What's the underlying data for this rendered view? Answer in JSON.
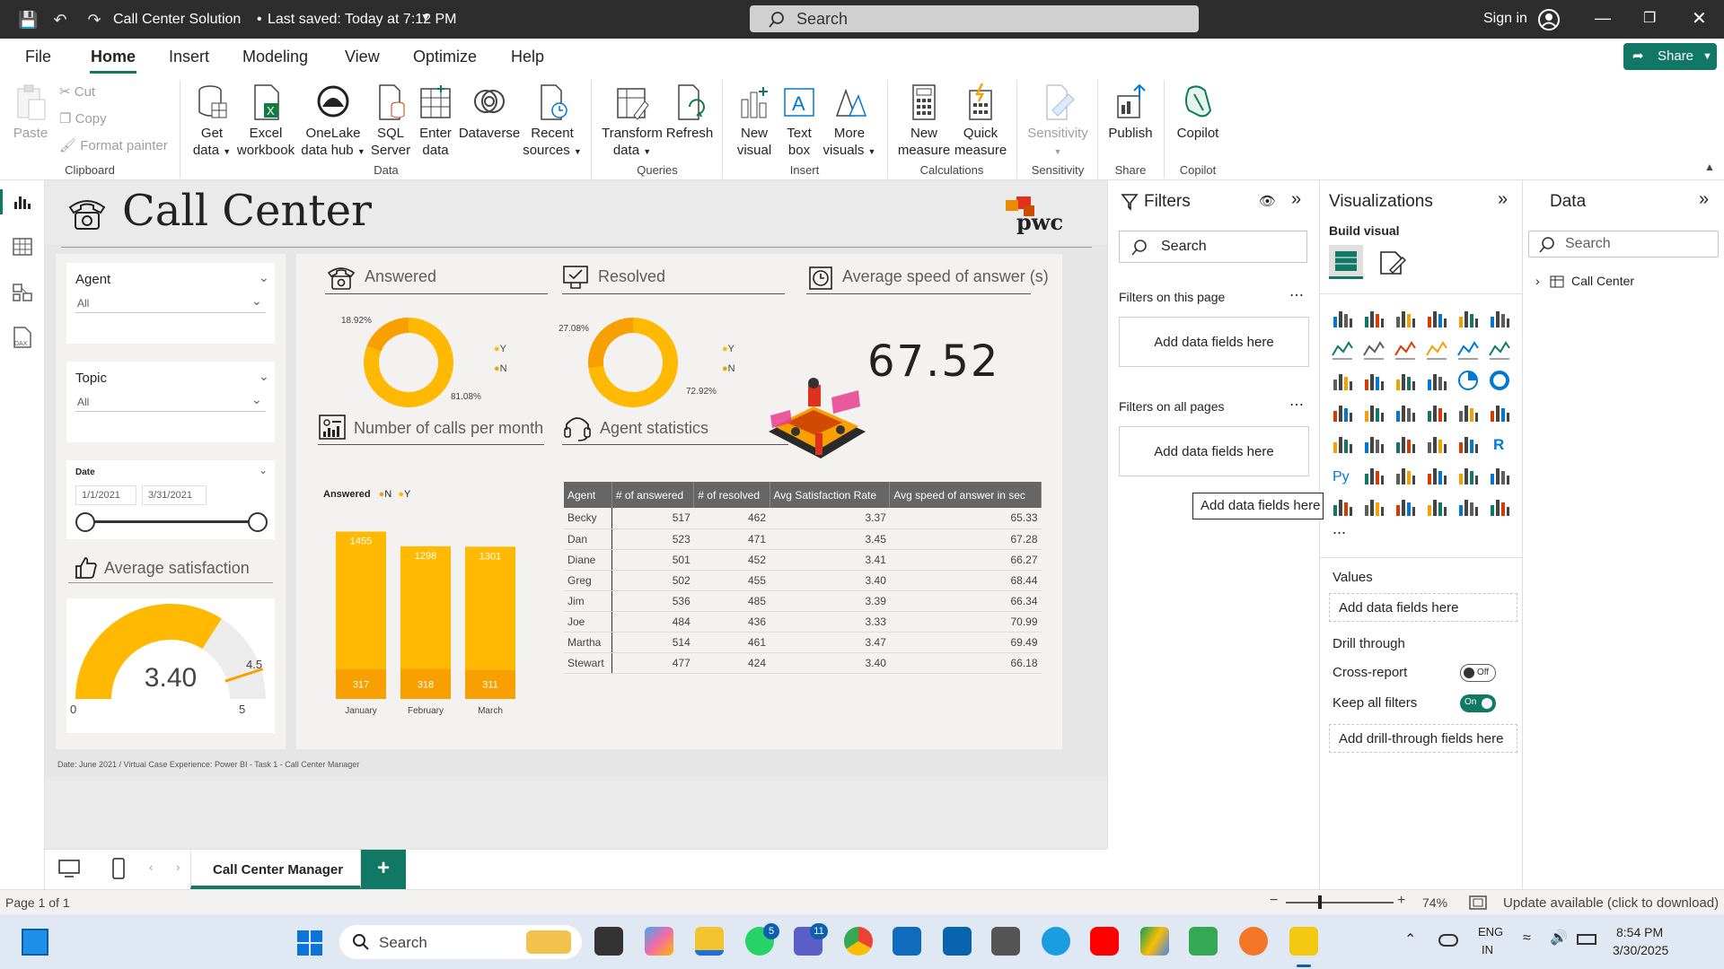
{
  "titlebar": {
    "title": "Call Center Solution",
    "saved": "Last saved: Today at 7:12 PM",
    "search_placeholder": "Search",
    "sign_in": "Sign in"
  },
  "menu": {
    "file": "File",
    "home": "Home",
    "insert": "Insert",
    "modeling": "Modeling",
    "view": "View",
    "optimize": "Optimize",
    "help": "Help",
    "share": "Share"
  },
  "ribbon": {
    "paste": "Paste",
    "cut": "Cut",
    "copy": "Copy",
    "format_painter": "Format painter",
    "clipboard": "Clipboard",
    "get_data": [
      "Get",
      "data"
    ],
    "excel": [
      "Excel",
      "workbook"
    ],
    "onelake": [
      "OneLake",
      "data hub"
    ],
    "sql": [
      "SQL",
      "Server"
    ],
    "enter": [
      "Enter",
      "data"
    ],
    "dataverse": "Dataverse",
    "recent": [
      "Recent",
      "sources"
    ],
    "data": "Data",
    "transform": [
      "Transform",
      "data"
    ],
    "refresh": "Refresh",
    "queries": "Queries",
    "new_visual": [
      "New",
      "visual"
    ],
    "text_box": [
      "Text",
      "box"
    ],
    "more_visuals": [
      "More",
      "visuals"
    ],
    "insert": "Insert",
    "new_measure": [
      "New",
      "measure"
    ],
    "quick_measure": [
      "Quick",
      "measure"
    ],
    "calculations": "Calculations",
    "sensitivity": "Sensitivity",
    "sensitivity_group": "Sensitivity",
    "publish": "Publish",
    "share_group": "Share",
    "copilot": "Copilot",
    "copilot_group": "Copilot"
  },
  "report": {
    "title": "Call Center",
    "logo": "pwc",
    "agent_label": "Agent",
    "agent_value": "All",
    "topic_label": "Topic",
    "topic_value": "All",
    "date_label": "Date",
    "date_from": "1/1/2021",
    "date_to": "3/31/2021",
    "avg_sat_title": "Average satisfaction",
    "avg_sat_value": "3.40",
    "gauge_min": "0",
    "gauge_max": "5",
    "gauge_target": "4.5",
    "answered_title": "Answered",
    "answered_y_pct": "81.08%",
    "answered_n_pct": "18.92%",
    "resolved_title": "Resolved",
    "resolved_y_pct": "72.92%",
    "resolved_n_pct": "27.08%",
    "legend_y": "Y",
    "legend_n": "N",
    "speed_title": "Average speed of answer (s)",
    "speed_value": "67.52",
    "calls_title": "Number of calls per month",
    "calls_legend_label": "Answered",
    "calls_legend_n": "N",
    "calls_legend_y": "Y",
    "agent_stats_title": "Agent statistics",
    "footer": "Date: June 2021 / Virtual Case Experience: Power BI - Task 1 - Call Center Manager",
    "table": {
      "headers": [
        "Agent",
        "# of answered",
        "# of resolved",
        "Avg Satisfaction Rate",
        "Avg speed of answer in sec"
      ],
      "rows": [
        [
          "Becky",
          "517",
          "462",
          "3.37",
          "65.33"
        ],
        [
          "Dan",
          "523",
          "471",
          "3.45",
          "67.28"
        ],
        [
          "Diane",
          "501",
          "452",
          "3.41",
          "66.27"
        ],
        [
          "Greg",
          "502",
          "455",
          "3.40",
          "68.44"
        ],
        [
          "Jim",
          "536",
          "485",
          "3.39",
          "66.34"
        ],
        [
          "Joe",
          "484",
          "436",
          "3.33",
          "70.99"
        ],
        [
          "Martha",
          "514",
          "461",
          "3.47",
          "69.49"
        ],
        [
          "Stewart",
          "477",
          "424",
          "3.40",
          "66.18"
        ]
      ]
    }
  },
  "chart_data": [
    {
      "type": "pie",
      "title": "Answered",
      "categories": [
        "Y",
        "N"
      ],
      "values": [
        81.08,
        18.92
      ],
      "colors": [
        "#FFB900",
        "#F7A000"
      ]
    },
    {
      "type": "pie",
      "title": "Resolved",
      "categories": [
        "Y",
        "N"
      ],
      "values": [
        72.92,
        27.08
      ],
      "colors": [
        "#FFB900",
        "#F7A000"
      ]
    },
    {
      "type": "bar",
      "title": "Number of calls per month",
      "categories": [
        "January",
        "February",
        "March"
      ],
      "series": [
        {
          "name": "N",
          "values": [
            317,
            318,
            311
          ]
        },
        {
          "name": "Y",
          "values": [
            1455,
            1298,
            1301
          ]
        }
      ],
      "stacked": true,
      "colors": [
        "#F7A000",
        "#FFB900"
      ]
    },
    {
      "type": "gauge",
      "title": "Average satisfaction",
      "value": 3.4,
      "min": 0,
      "max": 5,
      "target": 4.5
    }
  ],
  "filters": {
    "title": "Filters",
    "search": "Search",
    "this_page": "Filters on this page",
    "all_pages": "Filters on all pages",
    "add": "Add data fields here"
  },
  "visualizations": {
    "title": "Visualizations",
    "build": "Build visual",
    "tooltip": "Add data fields here",
    "values": "Values",
    "values_add": "Add data fields here",
    "drill": "Drill through",
    "cross_report": "Cross-report",
    "off": "Off",
    "keep_filters": "Keep all filters",
    "on": "On",
    "drill_add": "Add drill-through fields here",
    "more": "..."
  },
  "data_pane": {
    "title": "Data",
    "search": "Search",
    "table": "Call Center"
  },
  "pages": {
    "tab": "Call Center Manager",
    "add": "+"
  },
  "status": {
    "page": "Page 1 of 1",
    "zoom": "74%",
    "update": "Update available (click to download)"
  },
  "taskbar": {
    "search": "Search",
    "lang1": "ENG",
    "lang2": "IN",
    "time": "8:54 PM",
    "date": "3/30/2025",
    "whatsapp_badge": "5",
    "teams_badge": "11"
  }
}
